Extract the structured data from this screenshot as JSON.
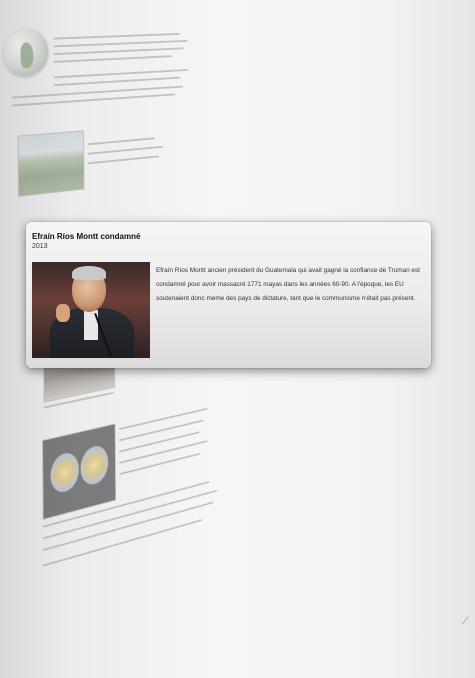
{
  "popup": {
    "title": "Efraín Ríos Montt condamné",
    "year": "2013",
    "description": "Efraín Ríos Montt ancien président du Guatemala qui avait gagné la confiance de Truman est condamné pour avoir massacré 1771 mayas dans les années 60-90. A l'époque, les EU soutenaient donc meme des pays de dictature, tant que le communisme n'était pas présent."
  },
  "icons": {
    "globe": "globe-icon",
    "corner": "page-curl-icon"
  }
}
